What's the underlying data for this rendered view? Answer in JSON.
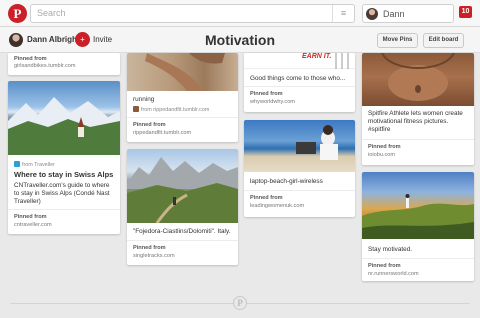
{
  "topbar": {
    "logo_glyph": "P",
    "search_placeholder": "Search",
    "search_menu_glyph": "≡",
    "user_name": "Dann",
    "notification_count": "10"
  },
  "board": {
    "owner_name": "Dann Albright",
    "invite_glyph": "+",
    "invite_label": "Invite",
    "title": "Motivation",
    "move_pins_label": "Move Pins",
    "edit_board_label": "Edit board"
  },
  "pins": {
    "p1": {
      "pinned_label": "Pinned from",
      "source": "girlsandbikes.tumblr.com"
    },
    "p2": {
      "via_label": "from Traveller",
      "title": "Where to stay in Swiss Alps",
      "description": "CNTraveller.com's guide to where to stay in Swiss Alps (Condé Nast Traveller)",
      "pinned_label": "Pinned from",
      "source": "cntraveller.com"
    },
    "p3": {
      "description": "running",
      "via_label": "from rippedandfit.tumblr.com",
      "pinned_label": "Pinned from",
      "source": "rippedandfit.tumblr.com"
    },
    "p4": {
      "description": "\"Fojedora-Ciastlins/Dolomiti\". Italy.",
      "pinned_label": "Pinned from",
      "source": "singletracks.com"
    },
    "p5": {
      "image_text": "EARN IT.",
      "description": "Good things come to those who...",
      "pinned_label": "Pinned from",
      "source": "whyworldwhy.com"
    },
    "p6": {
      "description": "laptop-beach-girl-wireless",
      "pinned_label": "Pinned from",
      "source": "leadingwomenuk.com"
    },
    "p7": {
      "description": "Spitfire Athlete lets women create motivational fitness pictures. #spitfire",
      "pinned_label": "Pinned from",
      "source": "ioiobu.com"
    },
    "p8": {
      "description": "Stay motivated.",
      "pinned_label": "Pinned from",
      "source": "nr.runnersworld.com"
    }
  },
  "footer": {
    "logo_glyph": "P"
  },
  "colors": {
    "brand_red": "#cb2027",
    "background": "#e9e9e9"
  }
}
